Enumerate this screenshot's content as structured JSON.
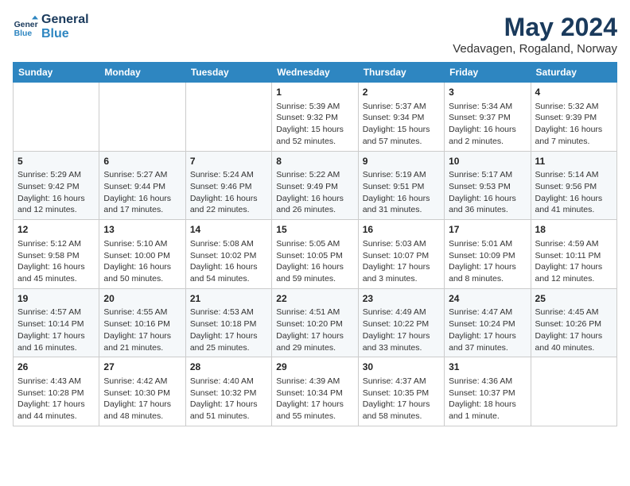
{
  "logo": {
    "line1": "General",
    "line2": "Blue"
  },
  "title": "May 2024",
  "subtitle": "Vedavagen, Rogaland, Norway",
  "days_of_week": [
    "Sunday",
    "Monday",
    "Tuesday",
    "Wednesday",
    "Thursday",
    "Friday",
    "Saturday"
  ],
  "weeks": [
    [
      {
        "day": "",
        "content": ""
      },
      {
        "day": "",
        "content": ""
      },
      {
        "day": "",
        "content": ""
      },
      {
        "day": "1",
        "content": "Sunrise: 5:39 AM\nSunset: 9:32 PM\nDaylight: 15 hours\nand 52 minutes."
      },
      {
        "day": "2",
        "content": "Sunrise: 5:37 AM\nSunset: 9:34 PM\nDaylight: 15 hours\nand 57 minutes."
      },
      {
        "day": "3",
        "content": "Sunrise: 5:34 AM\nSunset: 9:37 PM\nDaylight: 16 hours\nand 2 minutes."
      },
      {
        "day": "4",
        "content": "Sunrise: 5:32 AM\nSunset: 9:39 PM\nDaylight: 16 hours\nand 7 minutes."
      }
    ],
    [
      {
        "day": "5",
        "content": "Sunrise: 5:29 AM\nSunset: 9:42 PM\nDaylight: 16 hours\nand 12 minutes."
      },
      {
        "day": "6",
        "content": "Sunrise: 5:27 AM\nSunset: 9:44 PM\nDaylight: 16 hours\nand 17 minutes."
      },
      {
        "day": "7",
        "content": "Sunrise: 5:24 AM\nSunset: 9:46 PM\nDaylight: 16 hours\nand 22 minutes."
      },
      {
        "day": "8",
        "content": "Sunrise: 5:22 AM\nSunset: 9:49 PM\nDaylight: 16 hours\nand 26 minutes."
      },
      {
        "day": "9",
        "content": "Sunrise: 5:19 AM\nSunset: 9:51 PM\nDaylight: 16 hours\nand 31 minutes."
      },
      {
        "day": "10",
        "content": "Sunrise: 5:17 AM\nSunset: 9:53 PM\nDaylight: 16 hours\nand 36 minutes."
      },
      {
        "day": "11",
        "content": "Sunrise: 5:14 AM\nSunset: 9:56 PM\nDaylight: 16 hours\nand 41 minutes."
      }
    ],
    [
      {
        "day": "12",
        "content": "Sunrise: 5:12 AM\nSunset: 9:58 PM\nDaylight: 16 hours\nand 45 minutes."
      },
      {
        "day": "13",
        "content": "Sunrise: 5:10 AM\nSunset: 10:00 PM\nDaylight: 16 hours\nand 50 minutes."
      },
      {
        "day": "14",
        "content": "Sunrise: 5:08 AM\nSunset: 10:02 PM\nDaylight: 16 hours\nand 54 minutes."
      },
      {
        "day": "15",
        "content": "Sunrise: 5:05 AM\nSunset: 10:05 PM\nDaylight: 16 hours\nand 59 minutes."
      },
      {
        "day": "16",
        "content": "Sunrise: 5:03 AM\nSunset: 10:07 PM\nDaylight: 17 hours\nand 3 minutes."
      },
      {
        "day": "17",
        "content": "Sunrise: 5:01 AM\nSunset: 10:09 PM\nDaylight: 17 hours\nand 8 minutes."
      },
      {
        "day": "18",
        "content": "Sunrise: 4:59 AM\nSunset: 10:11 PM\nDaylight: 17 hours\nand 12 minutes."
      }
    ],
    [
      {
        "day": "19",
        "content": "Sunrise: 4:57 AM\nSunset: 10:14 PM\nDaylight: 17 hours\nand 16 minutes."
      },
      {
        "day": "20",
        "content": "Sunrise: 4:55 AM\nSunset: 10:16 PM\nDaylight: 17 hours\nand 21 minutes."
      },
      {
        "day": "21",
        "content": "Sunrise: 4:53 AM\nSunset: 10:18 PM\nDaylight: 17 hours\nand 25 minutes."
      },
      {
        "day": "22",
        "content": "Sunrise: 4:51 AM\nSunset: 10:20 PM\nDaylight: 17 hours\nand 29 minutes."
      },
      {
        "day": "23",
        "content": "Sunrise: 4:49 AM\nSunset: 10:22 PM\nDaylight: 17 hours\nand 33 minutes."
      },
      {
        "day": "24",
        "content": "Sunrise: 4:47 AM\nSunset: 10:24 PM\nDaylight: 17 hours\nand 37 minutes."
      },
      {
        "day": "25",
        "content": "Sunrise: 4:45 AM\nSunset: 10:26 PM\nDaylight: 17 hours\nand 40 minutes."
      }
    ],
    [
      {
        "day": "26",
        "content": "Sunrise: 4:43 AM\nSunset: 10:28 PM\nDaylight: 17 hours\nand 44 minutes."
      },
      {
        "day": "27",
        "content": "Sunrise: 4:42 AM\nSunset: 10:30 PM\nDaylight: 17 hours\nand 48 minutes."
      },
      {
        "day": "28",
        "content": "Sunrise: 4:40 AM\nSunset: 10:32 PM\nDaylight: 17 hours\nand 51 minutes."
      },
      {
        "day": "29",
        "content": "Sunrise: 4:39 AM\nSunset: 10:34 PM\nDaylight: 17 hours\nand 55 minutes."
      },
      {
        "day": "30",
        "content": "Sunrise: 4:37 AM\nSunset: 10:35 PM\nDaylight: 17 hours\nand 58 minutes."
      },
      {
        "day": "31",
        "content": "Sunrise: 4:36 AM\nSunset: 10:37 PM\nDaylight: 18 hours\nand 1 minute."
      },
      {
        "day": "",
        "content": ""
      }
    ]
  ]
}
